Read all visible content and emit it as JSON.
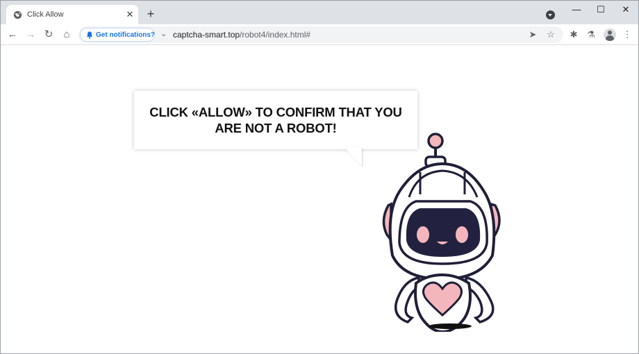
{
  "tab": {
    "title": "Click Allow",
    "close_glyph": "✕",
    "favicon": "globe-icon"
  },
  "new_tab_glyph": "+",
  "window_controls": {
    "minimize": "—",
    "maximize": "☐",
    "close": "✕"
  },
  "toolbar": {
    "back": "←",
    "forward": "→",
    "reload": "↻",
    "home": "⌂",
    "notification_chip": "Get notifications?",
    "url_host": "captcha-smart.top",
    "url_path": "/robot4/index.html#",
    "send_icon": "➤",
    "bookmark_icon": "☆",
    "extensions_icon": "✱",
    "labs_icon": "⚗",
    "menu_icon": "⋮"
  },
  "page": {
    "message_line1": "CLICK «ALLOW» TO CONFIRM THAT YOU",
    "message_line2": "ARE NOT A ROBOT!"
  },
  "colors": {
    "accent": "#1a73e8",
    "robot_outline": "#1f1f38",
    "robot_pink": "#f4b6bd",
    "robot_visor": "#222240"
  }
}
